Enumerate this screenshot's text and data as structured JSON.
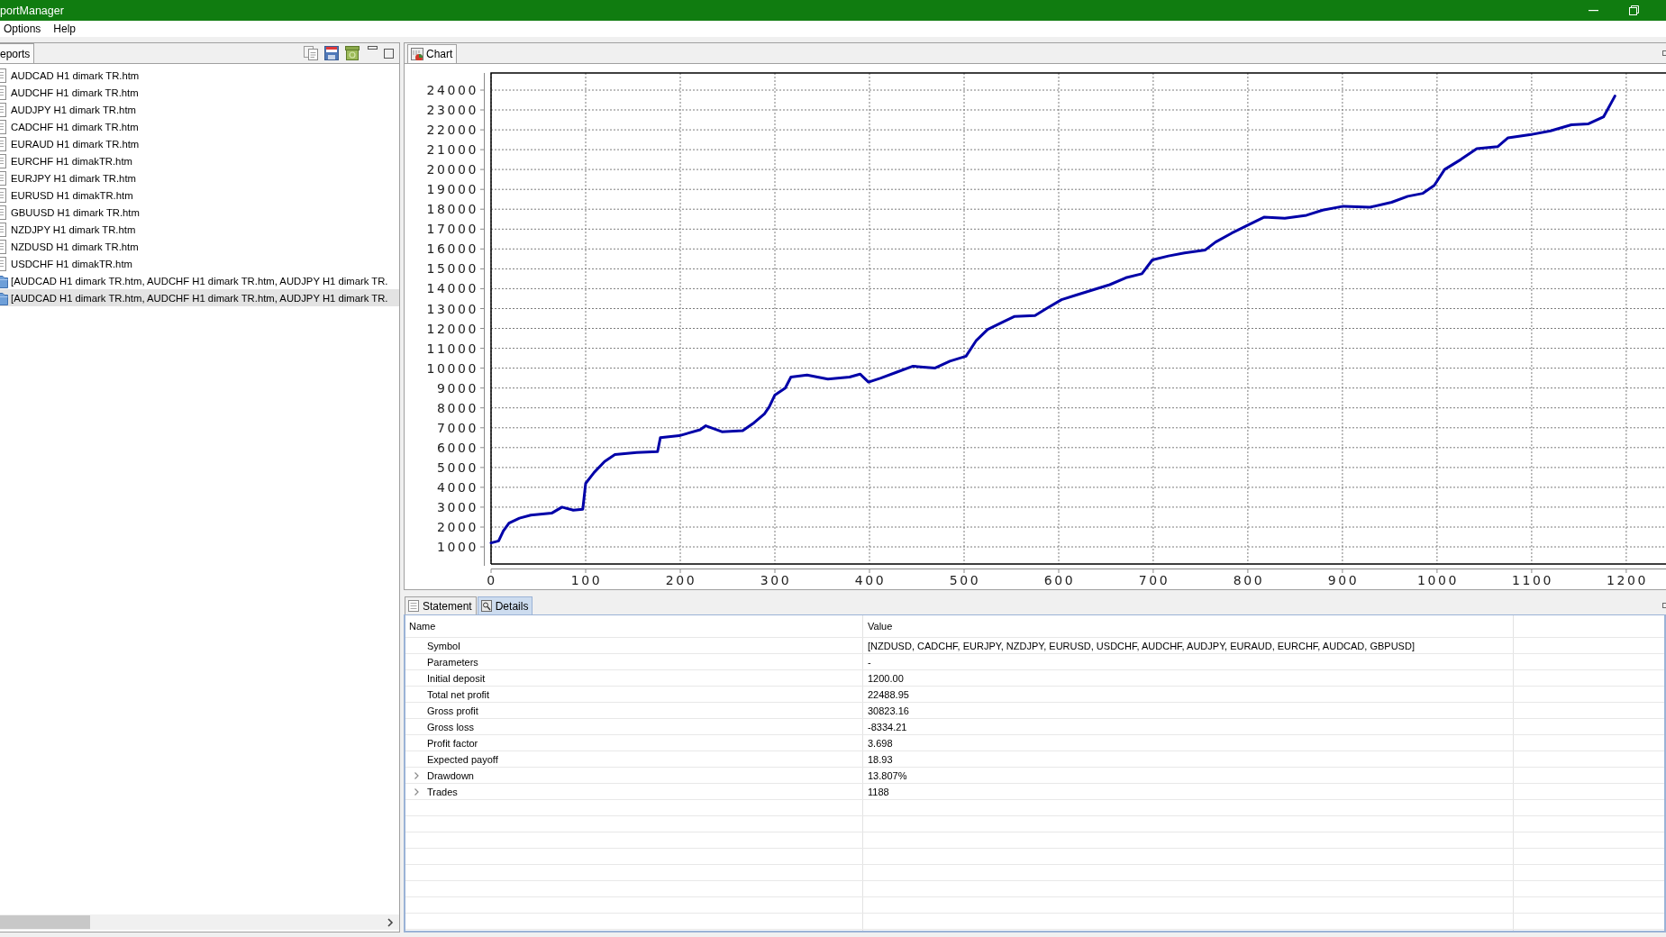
{
  "window": {
    "title": "portManager"
  },
  "menu": [
    {
      "label": "Options"
    },
    {
      "label": "Help"
    }
  ],
  "reports_panel": {
    "tabs": [
      {
        "label": "eports",
        "selected": true
      }
    ],
    "items": [
      {
        "kind": "file",
        "label": "AUDCAD H1 dimark TR.htm",
        "selected": false
      },
      {
        "kind": "file",
        "label": "AUDCHF H1 dimark TR.htm",
        "selected": false
      },
      {
        "kind": "file",
        "label": "AUDJPY H1 dimark TR.htm",
        "selected": false
      },
      {
        "kind": "file",
        "label": "CADCHF H1 dimark TR.htm",
        "selected": false
      },
      {
        "kind": "file",
        "label": "EURAUD H1 dimark TR.htm",
        "selected": false
      },
      {
        "kind": "file",
        "label": "EURCHF H1 dimakTR.htm",
        "selected": false
      },
      {
        "kind": "file",
        "label": "EURJPY H1 dimark TR.htm",
        "selected": false
      },
      {
        "kind": "file",
        "label": "EURUSD H1 dimakTR.htm",
        "selected": false
      },
      {
        "kind": "file",
        "label": "GBUUSD H1 dimark TR.htm",
        "selected": false
      },
      {
        "kind": "file",
        "label": "NZDJPY H1 dimark TR.htm",
        "selected": false
      },
      {
        "kind": "file",
        "label": "NZDUSD H1 dimark TR.htm",
        "selected": false
      },
      {
        "kind": "file",
        "label": "USDCHF H1 dimakTR.htm",
        "selected": false
      },
      {
        "kind": "group",
        "label": "[AUDCAD H1 dimark TR.htm, AUDCHF H1 dimark TR.htm, AUDJPY H1 dimark TR.",
        "selected": false
      },
      {
        "kind": "group",
        "label": "[AUDCAD H1 dimark TR.htm, AUDCHF H1 dimark TR.htm, AUDJPY H1 dimark TR.",
        "selected": true
      }
    ]
  },
  "chart_panel": {
    "tabs": [
      {
        "label": "Chart",
        "selected": true
      }
    ],
    "chart_data": [
      {
        "type": "line",
        "xlim": [
          0,
          1242
        ],
        "ylim": [
          140,
          24860
        ],
        "xticks": [
          0,
          100,
          200,
          300,
          400,
          500,
          600,
          700,
          800,
          900,
          1000,
          1100,
          1200
        ],
        "yticks": [
          1000,
          2000,
          3000,
          4000,
          5000,
          6000,
          7000,
          8000,
          9000,
          10000,
          11000,
          12000,
          13000,
          14000,
          15000,
          16000,
          17000,
          18000,
          19000,
          20000,
          21000,
          22000,
          23000,
          24000
        ],
        "grid": true,
        "color": "#0000a8",
        "x": [
          0,
          8,
          13,
          19,
          30,
          42,
          64,
          75,
          87,
          97,
          100,
          109,
          120,
          131,
          154,
          176,
          179,
          199,
          221,
          227,
          244,
          266,
          278,
          289,
          294,
          300,
          311,
          317,
          334,
          356,
          379,
          390,
          399,
          412,
          429,
          446,
          457,
          469,
          485,
          502,
          513,
          525,
          542,
          553,
          575,
          587,
          603,
          620,
          637,
          654,
          671,
          688,
          699,
          716,
          733,
          755,
          766,
          783,
          800,
          817,
          839,
          862,
          879,
          901,
          929,
          952,
          969,
          985,
          997,
          1008,
          1025,
          1042,
          1064,
          1075,
          1098,
          1120,
          1142,
          1160,
          1176,
          1188
        ],
        "values": [
          1200,
          1300,
          1800,
          2200,
          2450,
          2600,
          2700,
          3000,
          2850,
          2900,
          4200,
          4750,
          5300,
          5650,
          5750,
          5800,
          6500,
          6600,
          6900,
          7100,
          6800,
          6850,
          7250,
          7700,
          8050,
          8650,
          9000,
          9550,
          9650,
          9450,
          9550,
          9700,
          9300,
          9500,
          9800,
          10100,
          10050,
          10000,
          10350,
          10600,
          11400,
          11950,
          12350,
          12600,
          12650,
          13000,
          13450,
          13700,
          13950,
          14200,
          14550,
          14750,
          15450,
          15650,
          15800,
          15950,
          16350,
          16800,
          17200,
          17600,
          17550,
          17700,
          17950,
          18150,
          18100,
          18350,
          18650,
          18800,
          19200,
          20000,
          20500,
          21050,
          21150,
          21600,
          21750,
          21950,
          22250,
          22300,
          22650,
          23700
        ]
      }
    ]
  },
  "details_panel": {
    "tabs": [
      {
        "label": "Statement",
        "selected": false
      },
      {
        "label": "Details",
        "selected": true
      }
    ],
    "columns": [
      "Name",
      "Value"
    ],
    "rows": [
      {
        "name": "Symbol",
        "value": "[NZDUSD, CADCHF, EURJPY, NZDJPY, EURUSD, USDCHF, AUDCHF, AUDJPY, EURAUD, EURCHF, AUDCAD, GBPUSD]"
      },
      {
        "name": "Parameters",
        "value": "-"
      },
      {
        "name": "Initial deposit",
        "value": "1200.00"
      },
      {
        "name": "Total net profit",
        "value": "22488.95"
      },
      {
        "name": "Gross profit",
        "value": "30823.16"
      },
      {
        "name": "Gross loss",
        "value": "-8334.21"
      },
      {
        "name": "Profit factor",
        "value": "3.698"
      },
      {
        "name": "Expected payoff",
        "value": "18.93"
      },
      {
        "name": "Drawdown",
        "value": "13.807%",
        "expanded": false
      },
      {
        "name": "Trades",
        "value": "1188",
        "expanded": false
      }
    ]
  }
}
